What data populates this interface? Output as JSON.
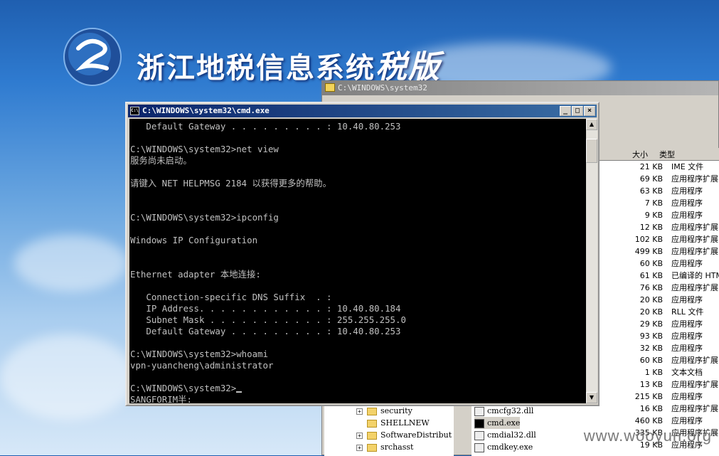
{
  "banner": {
    "title": "浙江地税信息系统",
    "title_suffix": "税版"
  },
  "explorer": {
    "title": "C:\\WINDOWS\\system32",
    "columns": {
      "size": "大小",
      "type": "类型"
    },
    "rows": [
      {
        "size": "21 KB",
        "type": "IME 文件"
      },
      {
        "size": "69 KB",
        "type": "应用程序扩展"
      },
      {
        "size": "63 KB",
        "type": "应用程序"
      },
      {
        "size": "7 KB",
        "type": "应用程序"
      },
      {
        "size": "9 KB",
        "type": "应用程序"
      },
      {
        "size": "12 KB",
        "type": "应用程序扩展"
      },
      {
        "size": "102 KB",
        "type": "应用程序扩展"
      },
      {
        "size": "499 KB",
        "type": "应用程序扩展"
      },
      {
        "size": "60 KB",
        "type": "应用程序"
      },
      {
        "size": "61 KB",
        "type": "已编译的 HTML"
      },
      {
        "size": "76 KB",
        "type": "应用程序扩展"
      },
      {
        "size": "20 KB",
        "type": "应用程序"
      },
      {
        "size": "20 KB",
        "type": "RLL 文件"
      },
      {
        "size": "29 KB",
        "type": "应用程序"
      },
      {
        "size": "93 KB",
        "type": "应用程序"
      },
      {
        "size": "32 KB",
        "type": "应用程序"
      },
      {
        "size": "60 KB",
        "type": "应用程序扩展"
      },
      {
        "size": "1 KB",
        "type": "文本文档"
      },
      {
        "size": "13 KB",
        "type": "应用程序扩展"
      },
      {
        "size": "215 KB",
        "type": "应用程序"
      },
      {
        "size": "16 KB",
        "type": "应用程序扩展"
      },
      {
        "size": "460 KB",
        "type": "应用程序"
      },
      {
        "size": "335 KB",
        "type": "应用程序扩展"
      },
      {
        "size": "19 KB",
        "type": "应用程序"
      }
    ],
    "tree": [
      "security",
      "SHELLNEW",
      "SoftwareDistribut",
      "srchasst"
    ],
    "files": [
      "cmcfg32.dll",
      "cmd.exe",
      "cmdial32.dll",
      "cmdkey.exe"
    ]
  },
  "cmd": {
    "title": "C:\\WINDOWS\\system32\\cmd.exe",
    "lines": [
      "   Default Gateway . . . . . . . . . : 10.40.80.253",
      "",
      "C:\\WINDOWS\\system32>net view",
      "服务尚未启动。",
      "",
      "请键入 NET HELPMSG 2184 以获得更多的帮助。",
      "",
      "",
      "C:\\WINDOWS\\system32>ipconfig",
      "",
      "Windows IP Configuration",
      "",
      "",
      "Ethernet adapter 本地连接:",
      "",
      "   Connection-specific DNS Suffix  . :",
      "   IP Address. . . . . . . . . . . . : 10.40.80.184",
      "   Subnet Mask . . . . . . . . . . . : 255.255.255.0",
      "   Default Gateway . . . . . . . . . : 10.40.80.253",
      "",
      "C:\\WINDOWS\\system32>whoami",
      "vpn-yuancheng\\administrator",
      "",
      "C:\\WINDOWS\\system32>",
      "SANGFORIM半:"
    ],
    "buttons": {
      "minimize": "_",
      "maximize": "□",
      "close": "×"
    },
    "scroll": {
      "up": "▲",
      "down": "▼"
    }
  },
  "watermark": "www.wooyun.org"
}
